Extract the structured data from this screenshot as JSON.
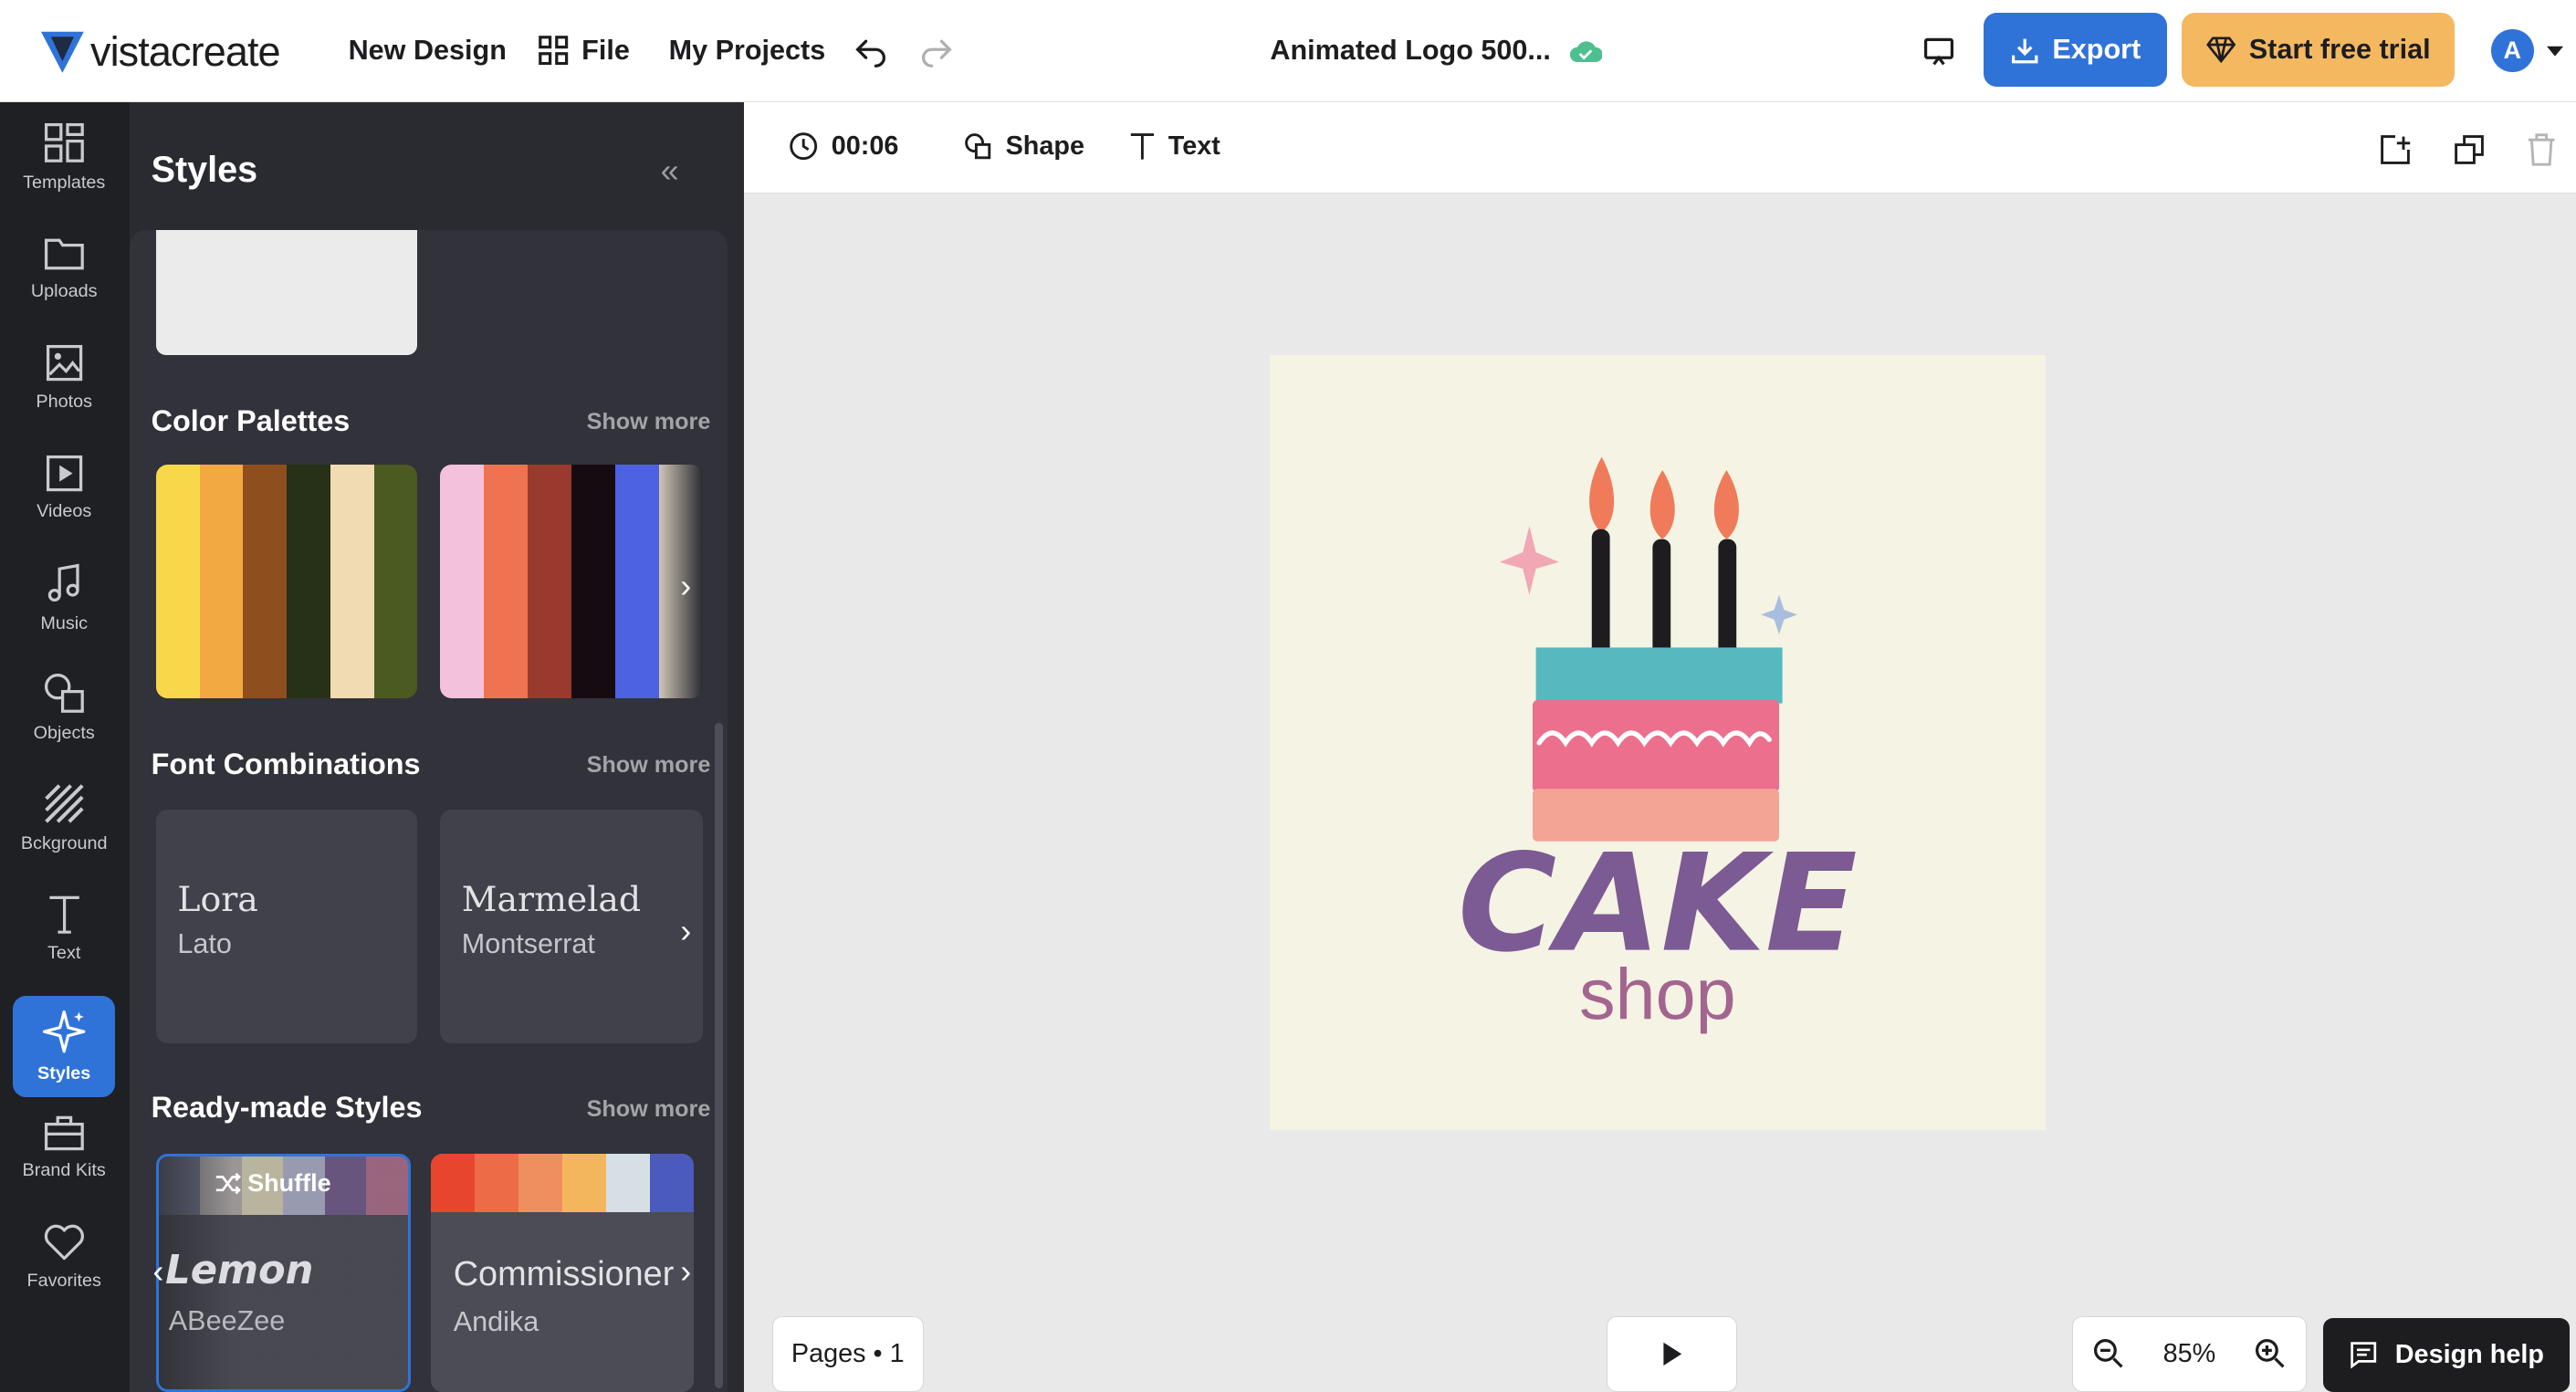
{
  "brand": {
    "name": "vistacreate"
  },
  "topbar": {
    "new_design": "New Design",
    "file": "File",
    "my_projects": "My Projects",
    "doc_title": "Animated Logo 500...",
    "export": "Export",
    "start_trial": "Start free trial",
    "avatar_initial": "A"
  },
  "rail": {
    "items": [
      {
        "label": "Templates",
        "icon": "templates-icon"
      },
      {
        "label": "Uploads",
        "icon": "folder-icon"
      },
      {
        "label": "Photos",
        "icon": "photo-icon"
      },
      {
        "label": "Videos",
        "icon": "video-icon"
      },
      {
        "label": "Music",
        "icon": "music-icon"
      },
      {
        "label": "Objects",
        "icon": "objects-icon"
      },
      {
        "label": "Bckground",
        "icon": "background-icon"
      },
      {
        "label": "Text",
        "icon": "text-icon"
      },
      {
        "label": "Styles",
        "icon": "sparkle-icon",
        "active": true
      },
      {
        "label": "Brand Kits",
        "icon": "briefcase-icon"
      },
      {
        "label": "Favorites",
        "icon": "heart-icon"
      }
    ]
  },
  "panel": {
    "title": "Styles",
    "color_palettes": {
      "title": "Color Palettes",
      "show_more": "Show more",
      "palettes": [
        [
          "#f8d84a",
          "#f2a942",
          "#8f4e1e",
          "#263117",
          "#f1dbb2",
          "#4b5a20"
        ],
        [
          "#f3c1dc",
          "#ef7351",
          "#9a3a2c",
          "#160b10",
          "#4d62e0",
          "#cfc6b6"
        ]
      ]
    },
    "font_combinations": {
      "title": "Font Combinations",
      "show_more": "Show more",
      "items": [
        {
          "main": "Lora",
          "sub": "Lato"
        },
        {
          "main": "Marmelad",
          "sub": "Montserrat"
        }
      ]
    },
    "ready_made": {
      "title": "Ready-made Styles",
      "show_more": "Show more",
      "shuffle": "Shuffle",
      "items": [
        {
          "main": "Lemon",
          "sub": "ABeeZee",
          "colors": [
            "#6b6f86",
            "#a7a2a2",
            "#c9c3a9",
            "#a4a8be",
            "#6f5a87",
            "#a66c86"
          ]
        },
        {
          "main": "Commissioner",
          "sub": "Andika",
          "colors": [
            "#e8452e",
            "#ee6b48",
            "#f08f5e",
            "#f4b65d",
            "#d7dfe6",
            "#4a5bbd"
          ]
        }
      ]
    }
  },
  "toolbar": {
    "duration": "00:06",
    "shape": "Shape",
    "text": "Text"
  },
  "canvas": {
    "title_text": "CAKE",
    "subtitle_text": "shop"
  },
  "bottom": {
    "pages": "Pages • 1",
    "zoom": "85%",
    "design_help": "Design help"
  }
}
